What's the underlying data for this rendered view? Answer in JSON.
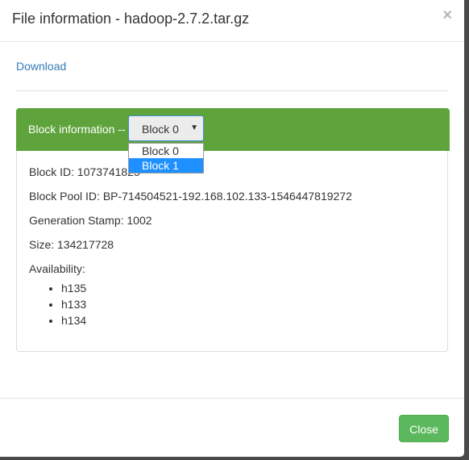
{
  "modal": {
    "title": "File information - hadoop-2.7.2.tar.gz",
    "close_glyph": "×"
  },
  "body": {
    "download_label": "Download"
  },
  "block_panel": {
    "heading_label": "Block information --",
    "select": {
      "selected": "Block 0",
      "options": [
        "Block 0",
        "Block 1"
      ],
      "highlighted_option": "Block 1"
    },
    "block_id": "Block ID: 1073741825",
    "block_pool_id": "Block Pool ID: BP-714504521-192.168.102.133-1546447819272",
    "generation_stamp": "Generation Stamp: 1002",
    "size": "Size: 134217728",
    "availability_label": "Availability:",
    "availability_hosts": [
      "h135",
      "h133",
      "h134"
    ]
  },
  "footer": {
    "close_label": "Close"
  },
  "colors": {
    "panel_heading": "#5fa33c",
    "link": "#337ab7",
    "button": "#5cb85c",
    "highlight": "#1e90ff"
  }
}
